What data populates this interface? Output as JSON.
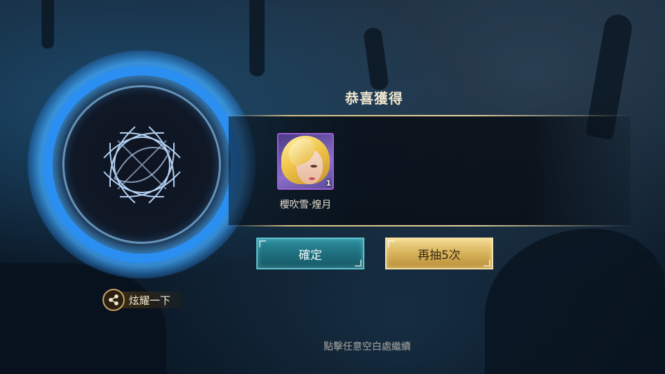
{
  "dialog": {
    "title": "恭喜獲得",
    "item": {
      "name": "櫻吹雪·煌月",
      "count": "1",
      "rarity_color": "#9c5fd6"
    }
  },
  "buttons": {
    "confirm_label": "確定",
    "retry_label": "再抽5次"
  },
  "share": {
    "label": "炫耀一下",
    "icon": "share-icon"
  },
  "hint": "點擊任意空白處繼續",
  "colors": {
    "accent_gold": "#d8bf83",
    "ring_blue": "#2a8ff0",
    "confirm_teal": "#1f6f7e",
    "retry_gold": "#d6b25a"
  }
}
